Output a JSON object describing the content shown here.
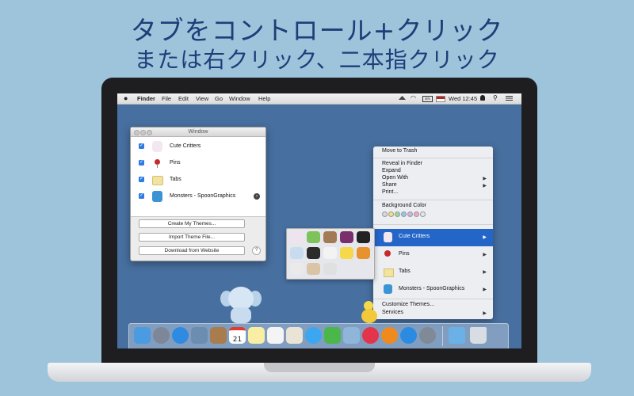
{
  "headline": {
    "line1": "タブをコントロール+クリック",
    "line2": "または右クリック、二本指クリック"
  },
  "menubar": {
    "apple_icon": "apple-logo-icon",
    "app_name": "Finder",
    "menus": [
      "File",
      "Edit",
      "View",
      "Go",
      "Window",
      "Help"
    ],
    "clock": "Wed 12:45",
    "battery_label": "EN"
  },
  "window": {
    "title": "Window",
    "items": [
      {
        "label": "Cute Critters",
        "checked": true,
        "icon": "critter-icon"
      },
      {
        "label": "Pins",
        "checked": true,
        "icon": "pin-icon"
      },
      {
        "label": "Tabs",
        "checked": true,
        "icon": "tab-icon"
      },
      {
        "label": "Monsters - SpoonGraphics",
        "checked": true,
        "icon": "monster-icon"
      }
    ],
    "buttons": {
      "create": "Create My Themes...",
      "import": "Import Theme File...",
      "download": "Download from Website"
    },
    "help_label": "?"
  },
  "context_menu": {
    "move_to_trash": "Move to Trash",
    "reveal": "Reveal in Finder",
    "expand": "Expand",
    "open_with": "Open With",
    "share": "Share",
    "print": "Print...",
    "background_color": "Background Color",
    "colors": [
      "#d9d9dd",
      "#f3e27a",
      "#9ad79b",
      "#8fc6ec",
      "#cfb3e4",
      "#f3a8c3",
      "#e6e6e6"
    ],
    "themes": [
      {
        "label": "Cute Critters",
        "highlighted": true
      },
      {
        "label": "Pins",
        "highlighted": false
      },
      {
        "label": "Tabs",
        "highlighted": false
      },
      {
        "label": "Monsters - SpoonGraphics",
        "highlighted": false
      }
    ],
    "customize": "Customize Themes...",
    "services": "Services"
  },
  "dock": {
    "icons": [
      "finder-icon",
      "launchpad-icon",
      "safari-icon",
      "photo-icon",
      "contacts-icon",
      "calendar-icon",
      "notes-icon",
      "reminders-icon",
      "textedit-icon",
      "messages-icon",
      "facetime-icon",
      "iphoto-icon",
      "itunes-icon",
      "ibooks-icon",
      "app-store-icon",
      "system-preferences-icon",
      "downloads-folder-icon",
      "trash-icon"
    ],
    "calendar_day": "21"
  },
  "colors": {
    "background": "#9ec4dc",
    "headline": "#1f3d78",
    "desktop": "#476f9f",
    "highlight": "#2465c8"
  }
}
